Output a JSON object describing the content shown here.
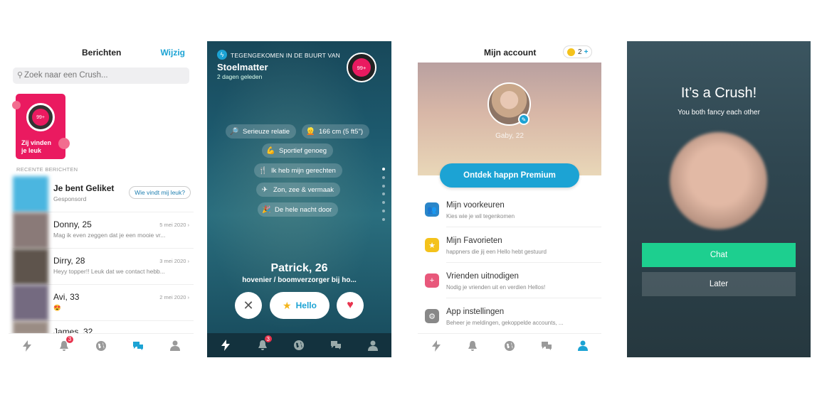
{
  "messages_screen": {
    "title": "Berichten",
    "edit_label": "Wijzig",
    "search_placeholder": "Zoek naar een Crush...",
    "likes_card": {
      "badge": "99+",
      "label": "Zij vinden je leuk"
    },
    "section_label": "RECENTE BERICHTEN",
    "conversations": [
      {
        "name": "Je bent Geliket",
        "subtitle": "Gesponsord",
        "action": "Wie vindt mij leuk?",
        "date": ""
      },
      {
        "name": "Donny, 25",
        "subtitle": "Mag ik even zeggen dat je een mooie vr...",
        "date": "5 mei 2020"
      },
      {
        "name": "Dirry, 28",
        "subtitle": "Heyy topper!! Leuk dat we contact hebb...",
        "date": "3 mei 2020"
      },
      {
        "name": "Avi, 33",
        "subtitle": "😍",
        "date": "2 mei 2020"
      },
      {
        "name": "James, 32",
        "subtitle": "",
        "date": ""
      }
    ],
    "tabbar": {
      "notification_count": "3"
    }
  },
  "profile_screen": {
    "crossed_label": "TEGENGEKOMEN IN DE BUURT VAN",
    "location": "Stoelmatter",
    "time_ago": "2 dagen geleden",
    "badge": "99+",
    "chips": [
      {
        "icon": "🔎",
        "label": "Serieuze relatie"
      },
      {
        "icon": "👱",
        "label": "166 cm (5 ft5\")"
      },
      {
        "icon": "💪",
        "label": "Sportief genoeg"
      },
      {
        "icon": "🍴",
        "label": "Ik heb mijn gerechten"
      },
      {
        "icon": "✈",
        "label": "Zon, zee & vermaak"
      },
      {
        "icon": "🎉",
        "label": "De hele nacht door"
      }
    ],
    "name": "Patrick, 26",
    "job": "hovenier / boomverzorger  bij ho...",
    "hello_label": "Hello",
    "tabbar": {
      "notification_count": "3"
    }
  },
  "account_screen": {
    "title": "Mijn account",
    "credits": "2",
    "user_name": "Gaby, 22",
    "premium_label": "Ontdek happn Premium",
    "items": [
      {
        "title": "Mijn voorkeuren",
        "subtitle": "Kies wie je wil tegenkomen",
        "color": "#2a86c9",
        "icon": "👥"
      },
      {
        "title": "Mijn Favorieten",
        "subtitle": "happners die jij een Hello hebt gestuurd",
        "color": "#f4c21b",
        "icon": "★"
      },
      {
        "title": "Vrienden uitnodigen",
        "subtitle": "Nodig je vrienden uit en verdien Hellos!",
        "color": "#e8587b",
        "icon": "+"
      },
      {
        "title": "App instellingen",
        "subtitle": "Beheer je meldingen, gekoppelde accounts, ...",
        "color": "#888888",
        "icon": "⚙"
      }
    ]
  },
  "crush_screen": {
    "title": "It’s a Crush!",
    "subtitle": "You both fancy each other",
    "chat_label": "Chat",
    "later_label": "Later"
  },
  "colors": {
    "accent": "#1ca3d4",
    "brand_pink": "#ea1a60",
    "chat_green": "#1dcf8f",
    "badge_red": "#e8344e"
  }
}
